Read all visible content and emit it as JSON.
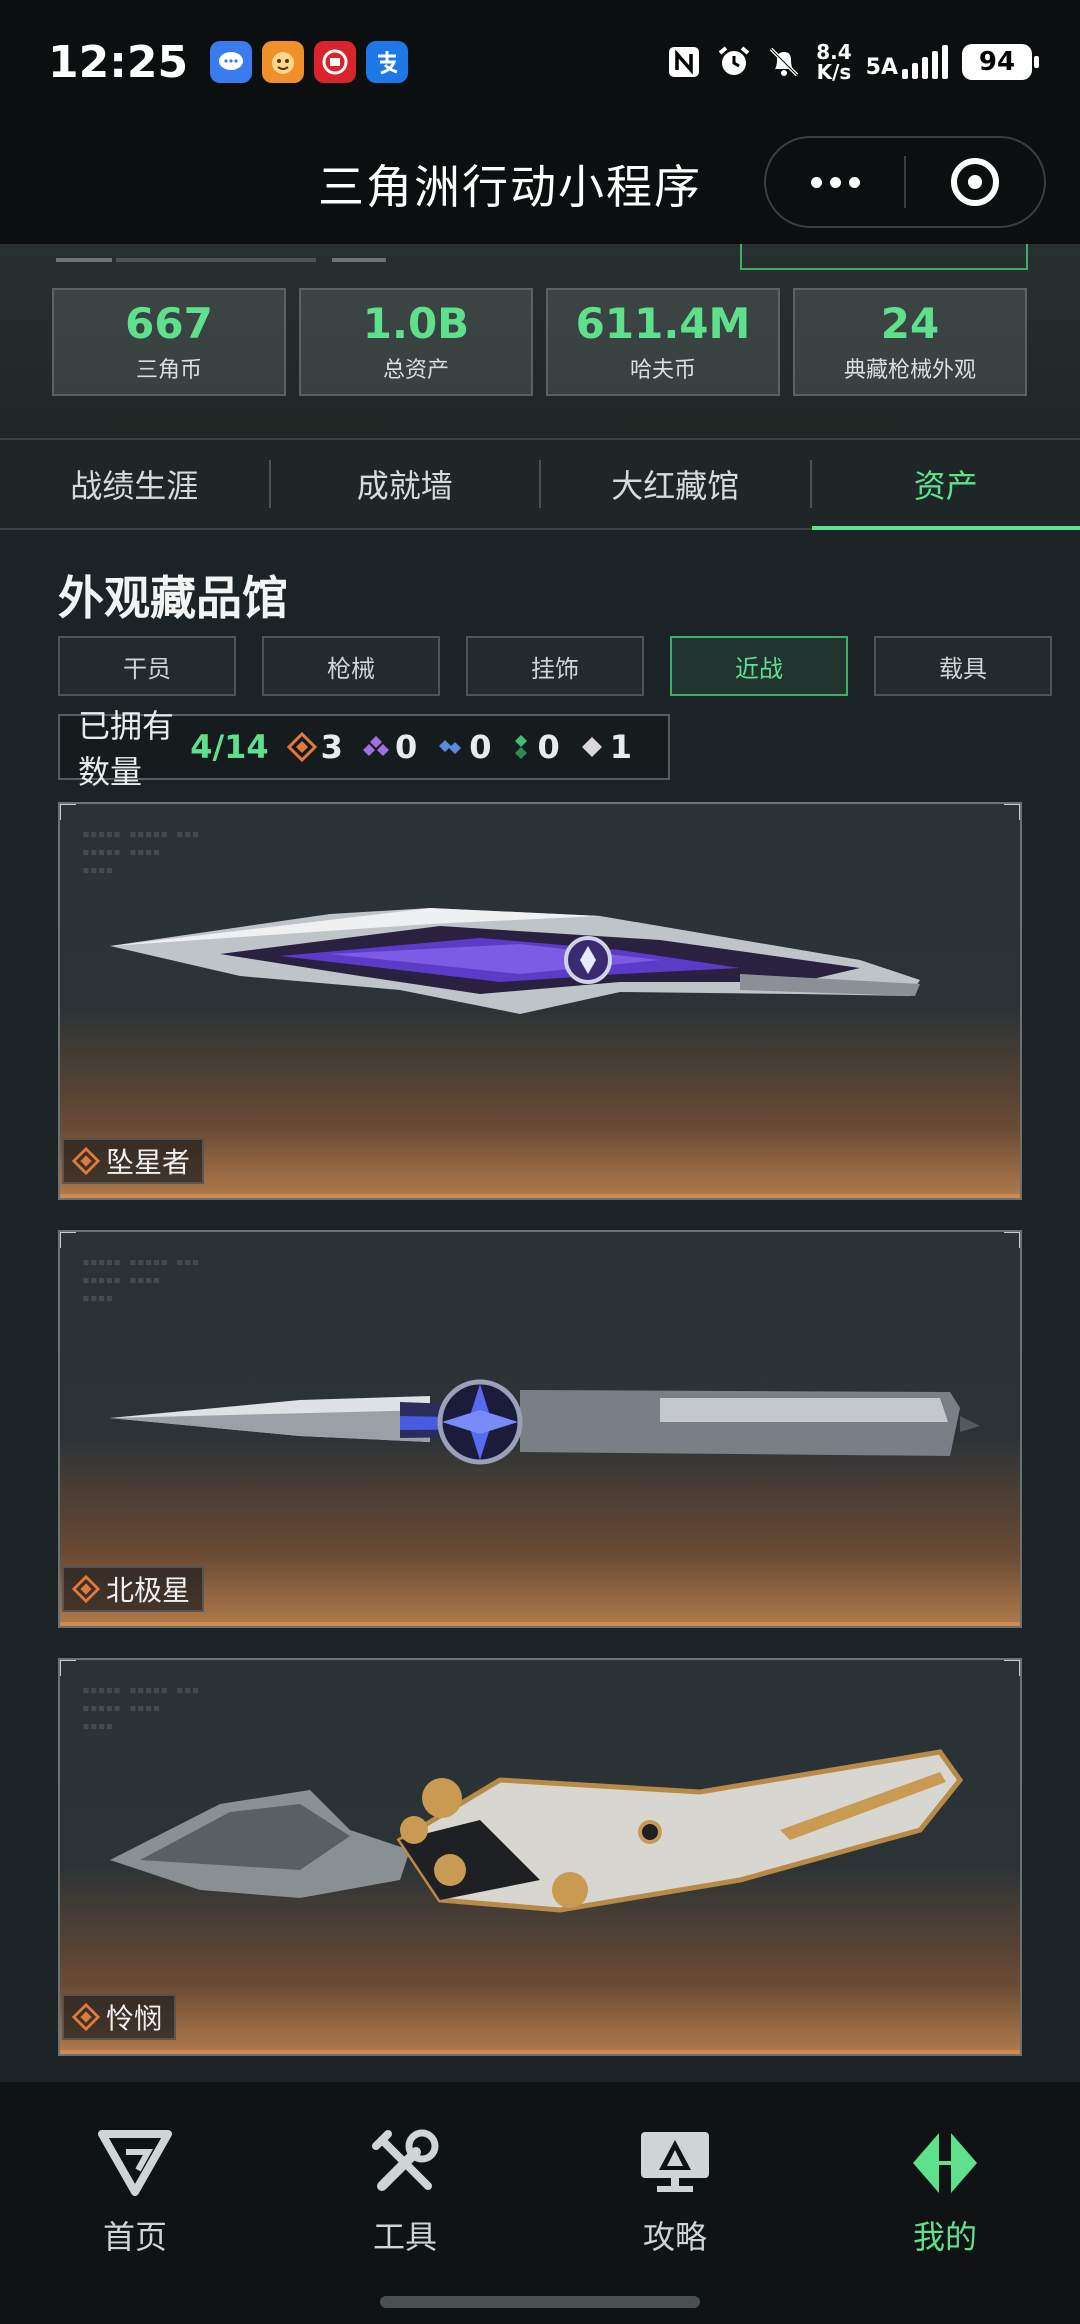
{
  "status_bar": {
    "time": "12:25",
    "speed_top": "8.4",
    "speed_bottom": "K/s",
    "network": "5A",
    "battery": "94"
  },
  "title_bar": {
    "title": "三角洲行动小程序"
  },
  "stats": [
    {
      "value": "667",
      "label": "三角币"
    },
    {
      "value": "1.0B",
      "label": "总资产"
    },
    {
      "value": "611.4M",
      "label": "哈夫币"
    },
    {
      "value": "24",
      "label": "典藏枪械外观"
    }
  ],
  "tabs": [
    {
      "label": "战绩生涯"
    },
    {
      "label": "成就墙"
    },
    {
      "label": "大红藏馆"
    },
    {
      "label": "资产"
    }
  ],
  "section": {
    "title": "外观藏品馆",
    "filters": [
      "干员",
      "枪械",
      "挂饰",
      "近战",
      "载具"
    ],
    "owned_label": "已拥有数量",
    "owned_count": "4/14",
    "rarity_counts": [
      {
        "color": "#e07a3c",
        "count": "3"
      },
      {
        "color": "#a070e0",
        "count": "0"
      },
      {
        "color": "#5a8ae0",
        "count": "0"
      },
      {
        "color": "#3fbf7a",
        "count": "0"
      },
      {
        "color": "#d8d8d8",
        "count": "1"
      }
    ]
  },
  "items": [
    {
      "name": "坠星者"
    },
    {
      "name": "北极星"
    },
    {
      "name": "怜悯"
    }
  ],
  "bottom_nav": [
    {
      "label": "首页"
    },
    {
      "label": "工具"
    },
    {
      "label": "攻略"
    },
    {
      "label": "我的"
    }
  ]
}
